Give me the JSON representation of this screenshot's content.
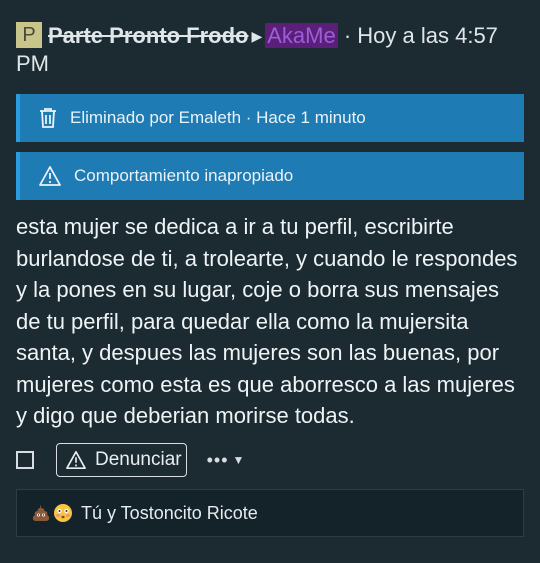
{
  "header": {
    "avatar_letter": "P",
    "author": "Parte Pronto Frodo",
    "arrow": "▶",
    "recipient": "AkaMe",
    "timestamp": "· Hoy a las 4:57 PM"
  },
  "notices": {
    "deleted": {
      "icon": "trash-icon",
      "text": "Eliminado por Emaleth · Hace 1 minuto"
    },
    "report": {
      "icon": "warning-icon",
      "text": "Comportamiento inapropiado"
    }
  },
  "message": {
    "text": "esta mujer se dedica a ir a tu perfil, escribirte burlandose de ti, a trolearte, y cuando le respondes y la pones en su lugar, coje o borra sus mensajes de tu perfil, para quedar ella como la mujersita santa, y despues las mujeres son las buenas, por mujeres como esta es que aborresco a las mujeres y digo que deberian morirse todas."
  },
  "actions": {
    "report_label": "Denunciar",
    "more_label": "•••",
    "caret": "▼"
  },
  "reactions": {
    "emojis": [
      "poop-emoji",
      "flushed-face-emoji"
    ],
    "text": "Tú y Tostoncito Ricote"
  },
  "colors": {
    "background": "#1c2b32",
    "notice": "#1f7bb3",
    "recipient_bg": "#5b1f7a",
    "recipient_fg": "#9b5ed6"
  }
}
